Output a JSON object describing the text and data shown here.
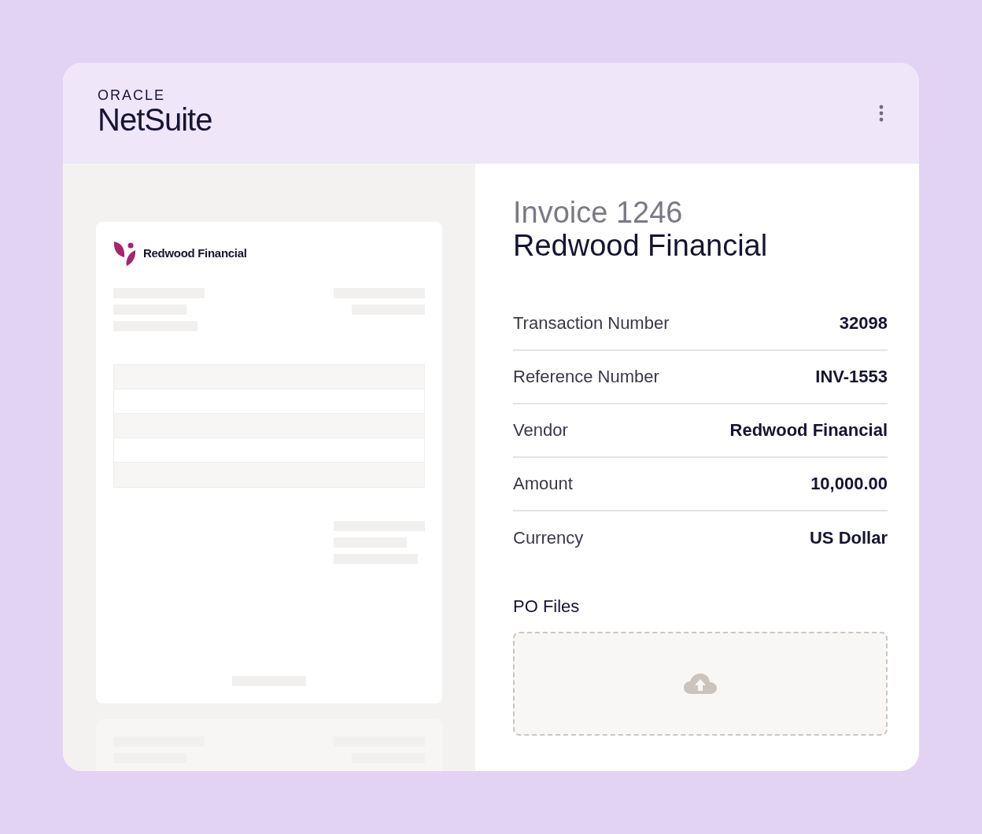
{
  "header": {
    "brand_top": "ORACLE",
    "brand": "NetSuite"
  },
  "document": {
    "company": "Redwood Financial"
  },
  "invoice": {
    "title": "Invoice 1246",
    "vendor": "Redwood Financial"
  },
  "fields": [
    {
      "label": "Transaction Number",
      "value": "32098"
    },
    {
      "label": "Reference Number",
      "value": "INV-1553"
    },
    {
      "label": "Vendor",
      "value": "Redwood Financial"
    },
    {
      "label": "Amount",
      "value": "10,000.00"
    },
    {
      "label": "Currency",
      "value": "US Dollar"
    }
  ],
  "po_files": {
    "label": "PO Files"
  }
}
